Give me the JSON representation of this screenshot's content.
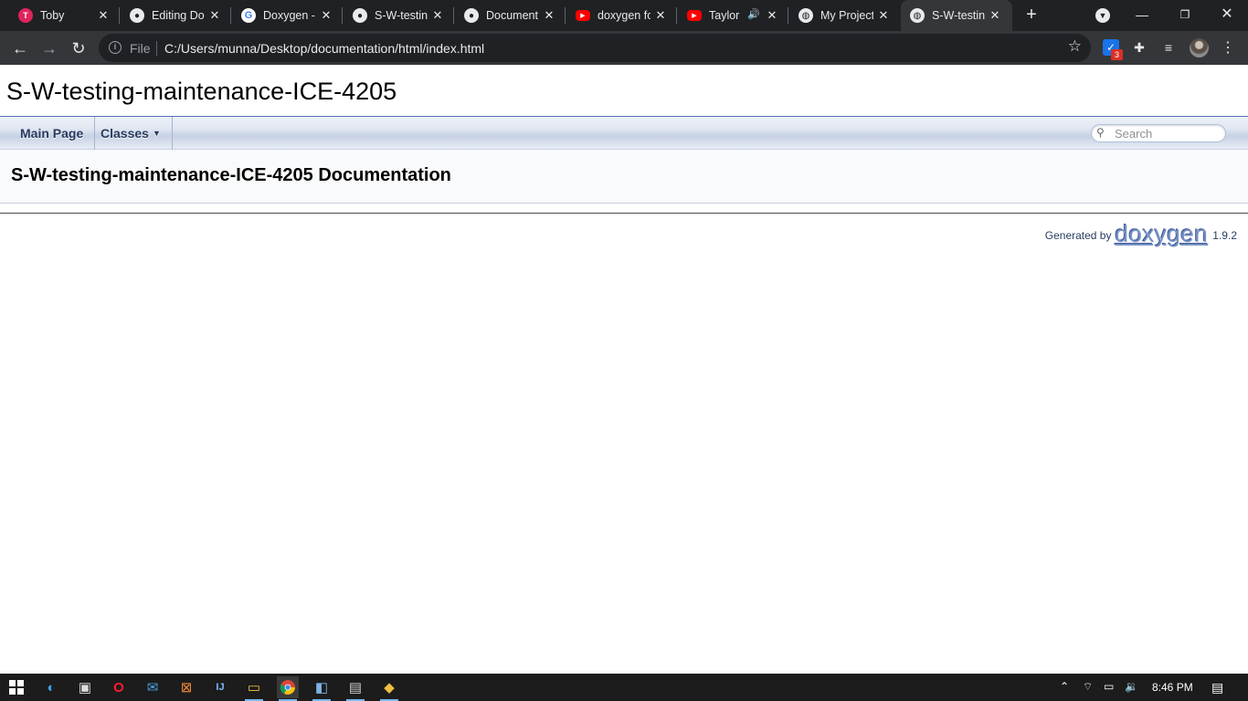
{
  "browser": {
    "tabs": [
      {
        "title": "Toby",
        "icon": "toby-icon"
      },
      {
        "title": "Editing Do",
        "icon": "github-icon"
      },
      {
        "title": "Doxygen -",
        "icon": "google-icon"
      },
      {
        "title": "S-W-testin",
        "icon": "github-icon"
      },
      {
        "title": "Document",
        "icon": "github-icon"
      },
      {
        "title": "doxygen fo",
        "icon": "youtube-icon"
      },
      {
        "title": "Taylor",
        "icon": "youtube-icon"
      },
      {
        "title": "My Project",
        "icon": "globe-icon"
      },
      {
        "title": "S-W-testin",
        "icon": "globe-icon"
      }
    ],
    "address": {
      "scheme_label": "File",
      "url": "C:/Users/munna/Desktop/documentation/html/index.html"
    },
    "extension_badge": "3"
  },
  "doc": {
    "project_name": "S-W-testing-maintenance-ICE-4205",
    "nav": {
      "main_page": "Main Page",
      "classes": "Classes"
    },
    "search_placeholder": "Search",
    "title": "S-W-testing-maintenance-ICE-4205 Documentation",
    "footer": {
      "generated_by": "Generated by",
      "logo_text": "doxygen",
      "version": "1.9.2"
    }
  },
  "taskbar": {
    "time": "8:46 PM"
  },
  "colors": {
    "chrome_dark": "#202124",
    "chrome_toolbar": "#35363a",
    "doxygen_nav_text": "#283a5d",
    "doxygen_border": "#5373b4",
    "taskbar": "#1c1c1c"
  }
}
